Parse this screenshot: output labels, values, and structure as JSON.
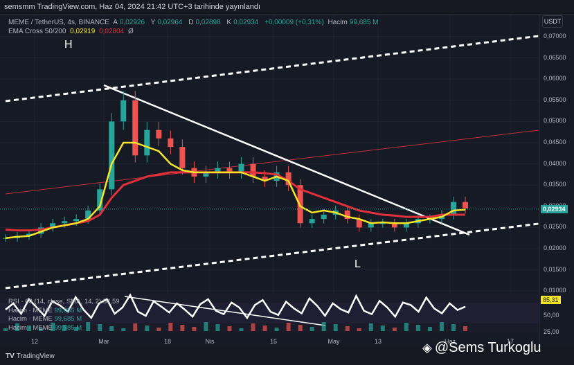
{
  "published": "semsmm TradingView.com, Haz 04, 2024 21:42 UTC+3 tarihinde yayınlandı",
  "legend": {
    "symbol": "MEME / TetherUS, 4s, BINANCE",
    "open_label": "A",
    "open": "0,02926",
    "high_label": "Y",
    "high": "0,02964",
    "low_label": "D",
    "low": "0,02898",
    "close_label": "K",
    "close": "0,02934",
    "change": "+0,00009 (+0,31%)",
    "volume_label": "Hacim",
    "volume": "99,685 M",
    "ema_label": "EMA Cross 50/200",
    "ema_fast": "0,02919",
    "ema_slow": "0,02804",
    "ema_extra": "Ø"
  },
  "rsi_legend": {
    "rsi": "RSI · 60 (14, close, SMA, 14, 2)",
    "rsi_value": "54,59",
    "vol1": "Hacim · MEME",
    "vol1_value": "99,685 M",
    "vol2": "Hacim · MEME",
    "vol2_value": "99,685 M",
    "vol3": "Hacim · MEME",
    "vol3_value": "99,685 M"
  },
  "annotations": {
    "high": "H",
    "low": "L"
  },
  "price_axis": {
    "currency": "USDT",
    "current_price": "0,02934",
    "rsi_current": "85,31",
    "rsi_ticks": [
      "50,00",
      "25,00"
    ]
  },
  "footer": {
    "logo": "TradingView",
    "watermark": "@Sems Turkoglu"
  },
  "colors": {
    "up": "#26a69a",
    "down": "#ef5350",
    "ema_fast": "#f5e627",
    "ema_slow": "#e0303b",
    "background": "#161a25"
  },
  "chart_data": {
    "type": "line",
    "title": "MEME / TetherUS, 4s, BINANCE",
    "xlabel": "",
    "ylabel": "USDT",
    "x_tick_labels": [
      "12",
      "Mar",
      "18",
      "Nis",
      "15",
      "May",
      "13",
      "Haz",
      "17"
    ],
    "y_ticks": [
      0.07,
      0.065,
      0.06,
      0.055,
      0.05,
      0.045,
      0.04,
      0.035,
      0.03,
      0.025,
      0.02,
      0.015,
      0.01
    ],
    "y_tick_labels": [
      "0,07000",
      "0,06500",
      "0,06000",
      "0,05500",
      "0,05000",
      "0,04500",
      "0,04000",
      "0,03500",
      "0,03000",
      "0,02500",
      "0,02000",
      "0,01500",
      "0,01000"
    ],
    "ylim": [
      0.0075,
      0.0745
    ],
    "grid": true,
    "series": [
      {
        "name": "Close",
        "values": [
          0.0225,
          0.023,
          0.0235,
          0.025,
          0.026,
          0.0265,
          0.027,
          0.029,
          0.034,
          0.05,
          0.055,
          0.042,
          0.048,
          0.046,
          0.044,
          0.039,
          0.037,
          0.038,
          0.039,
          0.038,
          0.04,
          0.037,
          0.036,
          0.038,
          0.035,
          0.026,
          0.027,
          0.028,
          0.029,
          0.027,
          0.025,
          0.026,
          0.026,
          0.025,
          0.026,
          0.027,
          0.027,
          0.028,
          0.031,
          0.0295
        ]
      },
      {
        "name": "EMA 50",
        "values": [
          0.0225,
          0.0228,
          0.023,
          0.024,
          0.025,
          0.0255,
          0.026,
          0.027,
          0.03,
          0.04,
          0.045,
          0.045,
          0.044,
          0.043,
          0.04,
          0.0385,
          0.038,
          0.038,
          0.038,
          0.038,
          0.038,
          0.037,
          0.036,
          0.037,
          0.036,
          0.03,
          0.0285,
          0.029,
          0.0285,
          0.0275,
          0.027,
          0.026,
          0.0262,
          0.026,
          0.026,
          0.0265,
          0.027,
          0.0275,
          0.029,
          0.0292
        ]
      },
      {
        "name": "EMA 200",
        "values": [
          0.0245,
          0.0243,
          0.0243,
          0.0245,
          0.025,
          0.0255,
          0.026,
          0.0265,
          0.028,
          0.032,
          0.035,
          0.036,
          0.037,
          0.0375,
          0.038,
          0.038,
          0.038,
          0.038,
          0.038,
          0.038,
          0.038,
          0.038,
          0.0378,
          0.0375,
          0.036,
          0.034,
          0.033,
          0.032,
          0.031,
          0.03,
          0.029,
          0.0285,
          0.028,
          0.0278,
          0.0275,
          0.0275,
          0.0275,
          0.028,
          0.028,
          0.028
        ]
      }
    ],
    "rsi": {
      "ylim": [
        0,
        100
      ],
      "values": [
        55,
        70,
        45,
        80,
        60,
        40,
        75,
        65,
        50,
        85,
        55,
        35,
        70,
        80,
        45,
        60,
        90,
        50,
        40,
        75,
        62,
        48,
        70,
        55,
        38,
        68,
        80,
        52,
        44,
        72,
        60,
        35,
        66,
        78,
        50,
        42,
        74,
        58,
        46,
        82,
        64,
        40,
        70,
        56,
        48,
        88,
        52,
        44,
        76,
        60,
        38,
        72,
        66,
        50,
        84,
        58,
        46,
        70,
        54,
        62
      ]
    }
  }
}
